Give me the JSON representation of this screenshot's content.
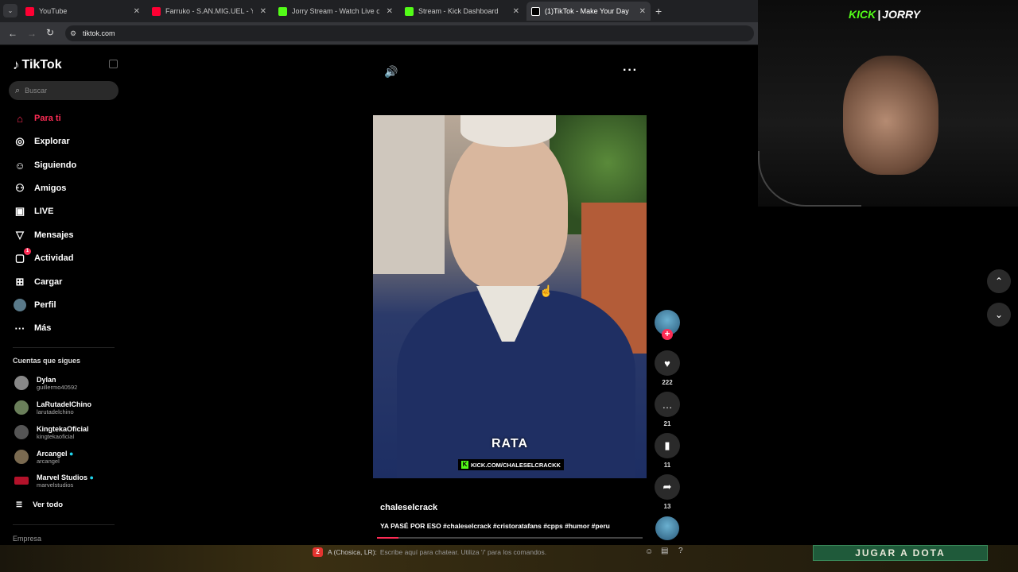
{
  "browser": {
    "tabs": [
      {
        "title": "YouTube",
        "color": "#ff0033"
      },
      {
        "title": "Farruko - S.AN.MIG.UEL - YouT",
        "color": "#ff0033"
      },
      {
        "title": "Jorry Stream - Watch Live on Ki",
        "color": "#53fc18"
      },
      {
        "title": "Stream - Kick Dashboard",
        "color": "#53fc18"
      },
      {
        "title": "(1)TikTok - Make Your Day",
        "color": "#ffffff"
      }
    ],
    "url": "tiktok.com"
  },
  "sidebar": {
    "logo": "TikTok",
    "search_placeholder": "Buscar",
    "nav": [
      {
        "label": "Para ti",
        "icon": "home-icon",
        "active": true
      },
      {
        "label": "Explorar",
        "icon": "compass-icon"
      },
      {
        "label": "Siguiendo",
        "icon": "following-icon"
      },
      {
        "label": "Amigos",
        "icon": "friends-icon"
      },
      {
        "label": "LIVE",
        "icon": "live-icon"
      },
      {
        "label": "Mensajes",
        "icon": "messages-icon"
      },
      {
        "label": "Actividad",
        "icon": "activity-icon",
        "badge": "1"
      },
      {
        "label": "Cargar",
        "icon": "upload-icon"
      },
      {
        "label": "Perfil",
        "icon": "profile-icon"
      },
      {
        "label": "Más",
        "icon": "more-icon"
      }
    ],
    "following_title": "Cuentas que sigues",
    "following": [
      {
        "name": "Dylan",
        "handle": "guillermo40592"
      },
      {
        "name": "LaRutadelChino",
        "handle": "larutadelchino"
      },
      {
        "name": "KingtekaOficial",
        "handle": "kingtekaoficial"
      },
      {
        "name": "Arcangel",
        "handle": "arcangel",
        "verified": true
      },
      {
        "name": "Marvel Studios",
        "handle": "marvelstudios",
        "verified": true
      }
    ],
    "see_all": "Ver todo",
    "footer": "Empresa"
  },
  "video": {
    "caption_big": "RATA",
    "watermark": "KICK.COM/CHALESELCRACKK",
    "author": "chaleselcrack",
    "description": "YA PASÉ POR ESO #chaleselcrack #cristoratafans #cpps #humor #peru",
    "likes": "222",
    "comments": "21",
    "saves": "11",
    "shares": "13"
  },
  "overlay": {
    "kick_logo": "KICK",
    "kick_user": "JORRY",
    "chat_count": "2",
    "chat_user": "A (Chosica, LR):",
    "chat_placeholder": "Escribe aquí para chatear. Utiliza '/' para los comandos.",
    "banner": "JUGAR A DOTA"
  }
}
